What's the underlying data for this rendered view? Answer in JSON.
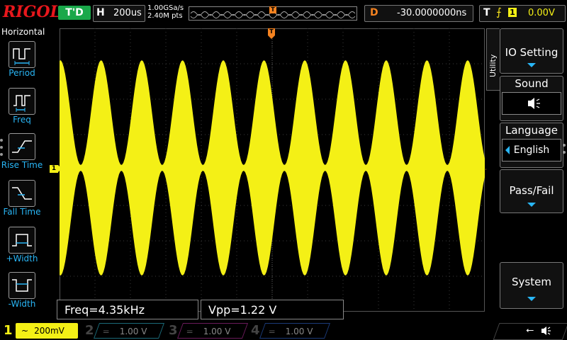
{
  "header": {
    "brand": "RIGOL",
    "run_state": "T'D",
    "timebase_label": "H",
    "timebase_value": "200us",
    "sample_rate": "1.00GSa/s",
    "memory_depth": "2.40M pts",
    "delay_label": "D",
    "delay_value": "-30.0000000ns",
    "trigger_label": "T",
    "trigger_source": "1",
    "trigger_level": "0.00V"
  },
  "left_menu": {
    "title": "Horizontal",
    "items": [
      {
        "label": "Period",
        "icon": "period-icon"
      },
      {
        "label": "Freq",
        "icon": "freq-icon"
      },
      {
        "label": "Rise Time",
        "icon": "rise-time-icon"
      },
      {
        "label": "Fall Time",
        "icon": "fall-time-icon"
      },
      {
        "label": "+Width",
        "icon": "pos-width-icon"
      },
      {
        "label": "-Width",
        "icon": "neg-width-icon"
      }
    ]
  },
  "markers": {
    "channel_marker": "1",
    "trigger_marker": "T"
  },
  "measurements": [
    {
      "text": "Freq=4.35kHz"
    },
    {
      "text": "Vpp=1.22 V"
    }
  ],
  "right_menu": {
    "tab_label": "Utility",
    "io_setting": "IO Setting",
    "sound": "Sound",
    "language": "Language",
    "language_value": "English",
    "pass_fail": "Pass/Fail",
    "system": "System"
  },
  "channels": [
    {
      "num": "1",
      "scale": "200mV",
      "color": "#f4f016",
      "active": true
    },
    {
      "num": "2",
      "scale": "1.00 V",
      "color": "#00c8e8",
      "active": false
    },
    {
      "num": "3",
      "scale": "1.00 V",
      "color": "#e030c0",
      "active": false
    },
    {
      "num": "4",
      "scale": "1.00 V",
      "color": "#2060ff",
      "active": false
    }
  ],
  "colors": {
    "trace": "#f4f016",
    "accent": "#29b6f6",
    "trigger": "#f48220",
    "brand": "#e8171c",
    "run": "#1aa84a"
  }
}
